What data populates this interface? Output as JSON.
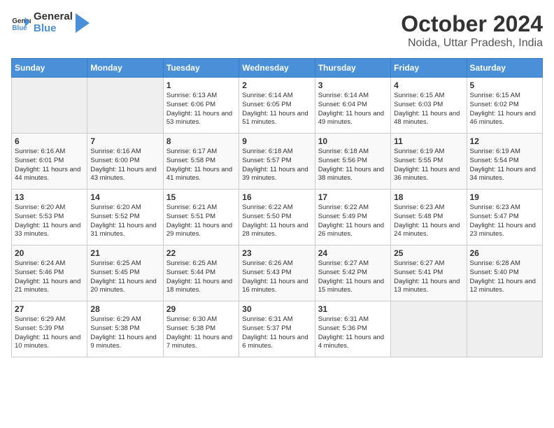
{
  "header": {
    "logo_line1": "General",
    "logo_line2": "Blue",
    "month": "October 2024",
    "location": "Noida, Uttar Pradesh, India"
  },
  "weekdays": [
    "Sunday",
    "Monday",
    "Tuesday",
    "Wednesday",
    "Thursday",
    "Friday",
    "Saturday"
  ],
  "weeks": [
    [
      {
        "day": "",
        "empty": true
      },
      {
        "day": "",
        "empty": true
      },
      {
        "day": "1",
        "sunrise": "Sunrise: 6:13 AM",
        "sunset": "Sunset: 6:06 PM",
        "daylight": "Daylight: 11 hours and 53 minutes."
      },
      {
        "day": "2",
        "sunrise": "Sunrise: 6:14 AM",
        "sunset": "Sunset: 6:05 PM",
        "daylight": "Daylight: 11 hours and 51 minutes."
      },
      {
        "day": "3",
        "sunrise": "Sunrise: 6:14 AM",
        "sunset": "Sunset: 6:04 PM",
        "daylight": "Daylight: 11 hours and 49 minutes."
      },
      {
        "day": "4",
        "sunrise": "Sunrise: 6:15 AM",
        "sunset": "Sunset: 6:03 PM",
        "daylight": "Daylight: 11 hours and 48 minutes."
      },
      {
        "day": "5",
        "sunrise": "Sunrise: 6:15 AM",
        "sunset": "Sunset: 6:02 PM",
        "daylight": "Daylight: 11 hours and 46 minutes."
      }
    ],
    [
      {
        "day": "6",
        "sunrise": "Sunrise: 6:16 AM",
        "sunset": "Sunset: 6:01 PM",
        "daylight": "Daylight: 11 hours and 44 minutes."
      },
      {
        "day": "7",
        "sunrise": "Sunrise: 6:16 AM",
        "sunset": "Sunset: 6:00 PM",
        "daylight": "Daylight: 11 hours and 43 minutes."
      },
      {
        "day": "8",
        "sunrise": "Sunrise: 6:17 AM",
        "sunset": "Sunset: 5:58 PM",
        "daylight": "Daylight: 11 hours and 41 minutes."
      },
      {
        "day": "9",
        "sunrise": "Sunrise: 6:18 AM",
        "sunset": "Sunset: 5:57 PM",
        "daylight": "Daylight: 11 hours and 39 minutes."
      },
      {
        "day": "10",
        "sunrise": "Sunrise: 6:18 AM",
        "sunset": "Sunset: 5:56 PM",
        "daylight": "Daylight: 11 hours and 38 minutes."
      },
      {
        "day": "11",
        "sunrise": "Sunrise: 6:19 AM",
        "sunset": "Sunset: 5:55 PM",
        "daylight": "Daylight: 11 hours and 36 minutes."
      },
      {
        "day": "12",
        "sunrise": "Sunrise: 6:19 AM",
        "sunset": "Sunset: 5:54 PM",
        "daylight": "Daylight: 11 hours and 34 minutes."
      }
    ],
    [
      {
        "day": "13",
        "sunrise": "Sunrise: 6:20 AM",
        "sunset": "Sunset: 5:53 PM",
        "daylight": "Daylight: 11 hours and 33 minutes."
      },
      {
        "day": "14",
        "sunrise": "Sunrise: 6:20 AM",
        "sunset": "Sunset: 5:52 PM",
        "daylight": "Daylight: 11 hours and 31 minutes."
      },
      {
        "day": "15",
        "sunrise": "Sunrise: 6:21 AM",
        "sunset": "Sunset: 5:51 PM",
        "daylight": "Daylight: 11 hours and 29 minutes."
      },
      {
        "day": "16",
        "sunrise": "Sunrise: 6:22 AM",
        "sunset": "Sunset: 5:50 PM",
        "daylight": "Daylight: 11 hours and 28 minutes."
      },
      {
        "day": "17",
        "sunrise": "Sunrise: 6:22 AM",
        "sunset": "Sunset: 5:49 PM",
        "daylight": "Daylight: 11 hours and 26 minutes."
      },
      {
        "day": "18",
        "sunrise": "Sunrise: 6:23 AM",
        "sunset": "Sunset: 5:48 PM",
        "daylight": "Daylight: 11 hours and 24 minutes."
      },
      {
        "day": "19",
        "sunrise": "Sunrise: 6:23 AM",
        "sunset": "Sunset: 5:47 PM",
        "daylight": "Daylight: 11 hours and 23 minutes."
      }
    ],
    [
      {
        "day": "20",
        "sunrise": "Sunrise: 6:24 AM",
        "sunset": "Sunset: 5:46 PM",
        "daylight": "Daylight: 11 hours and 21 minutes."
      },
      {
        "day": "21",
        "sunrise": "Sunrise: 6:25 AM",
        "sunset": "Sunset: 5:45 PM",
        "daylight": "Daylight: 11 hours and 20 minutes."
      },
      {
        "day": "22",
        "sunrise": "Sunrise: 6:25 AM",
        "sunset": "Sunset: 5:44 PM",
        "daylight": "Daylight: 11 hours and 18 minutes."
      },
      {
        "day": "23",
        "sunrise": "Sunrise: 6:26 AM",
        "sunset": "Sunset: 5:43 PM",
        "daylight": "Daylight: 11 hours and 16 minutes."
      },
      {
        "day": "24",
        "sunrise": "Sunrise: 6:27 AM",
        "sunset": "Sunset: 5:42 PM",
        "daylight": "Daylight: 11 hours and 15 minutes."
      },
      {
        "day": "25",
        "sunrise": "Sunrise: 6:27 AM",
        "sunset": "Sunset: 5:41 PM",
        "daylight": "Daylight: 11 hours and 13 minutes."
      },
      {
        "day": "26",
        "sunrise": "Sunrise: 6:28 AM",
        "sunset": "Sunset: 5:40 PM",
        "daylight": "Daylight: 11 hours and 12 minutes."
      }
    ],
    [
      {
        "day": "27",
        "sunrise": "Sunrise: 6:29 AM",
        "sunset": "Sunset: 5:39 PM",
        "daylight": "Daylight: 11 hours and 10 minutes."
      },
      {
        "day": "28",
        "sunrise": "Sunrise: 6:29 AM",
        "sunset": "Sunset: 5:38 PM",
        "daylight": "Daylight: 11 hours and 9 minutes."
      },
      {
        "day": "29",
        "sunrise": "Sunrise: 6:30 AM",
        "sunset": "Sunset: 5:38 PM",
        "daylight": "Daylight: 11 hours and 7 minutes."
      },
      {
        "day": "30",
        "sunrise": "Sunrise: 6:31 AM",
        "sunset": "Sunset: 5:37 PM",
        "daylight": "Daylight: 11 hours and 6 minutes."
      },
      {
        "day": "31",
        "sunrise": "Sunrise: 6:31 AM",
        "sunset": "Sunset: 5:36 PM",
        "daylight": "Daylight: 11 hours and 4 minutes."
      },
      {
        "day": "",
        "empty": true
      },
      {
        "day": "",
        "empty": true
      }
    ]
  ]
}
